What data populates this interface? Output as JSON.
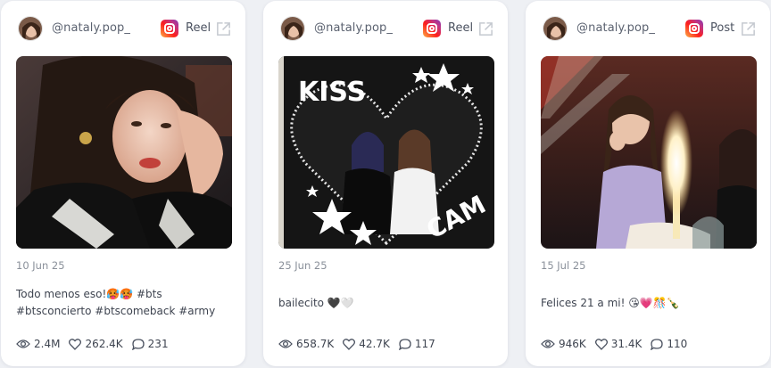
{
  "posts": [
    {
      "username": "@nataly.pop_",
      "type": "Reel",
      "date": "10 Jun 25",
      "caption_line1": "Todo menos eso!🥵🥵 #bts",
      "caption_line2": "#btsconcierto #btscomeback #army",
      "views": "2.4M",
      "likes": "262.4K",
      "comments": "231"
    },
    {
      "username": "@nataly.pop_",
      "type": "Reel",
      "date": "25 Jun 25",
      "caption_line1": "bailecito 🖤🤍",
      "views": "658.7K",
      "likes": "42.7K",
      "comments": "117",
      "image_text_top": "KISS",
      "image_text_bottom": "CAM"
    },
    {
      "username": "@nataly.pop_",
      "type": "Post",
      "date": "15 Jul 25",
      "caption_line1": "Felices 21 a mi! 😘💗🎊🍾",
      "views": "946K",
      "likes": "31.4K",
      "comments": "110"
    }
  ],
  "icons": {
    "platform": "instagram-icon",
    "open": "external-link-icon",
    "views": "eye-icon",
    "likes": "heart-icon",
    "comments": "comment-icon"
  },
  "colors": {
    "background": "#eef0f4",
    "card": "#ffffff",
    "text_muted": "#8a909a",
    "text": "#3e4450"
  }
}
